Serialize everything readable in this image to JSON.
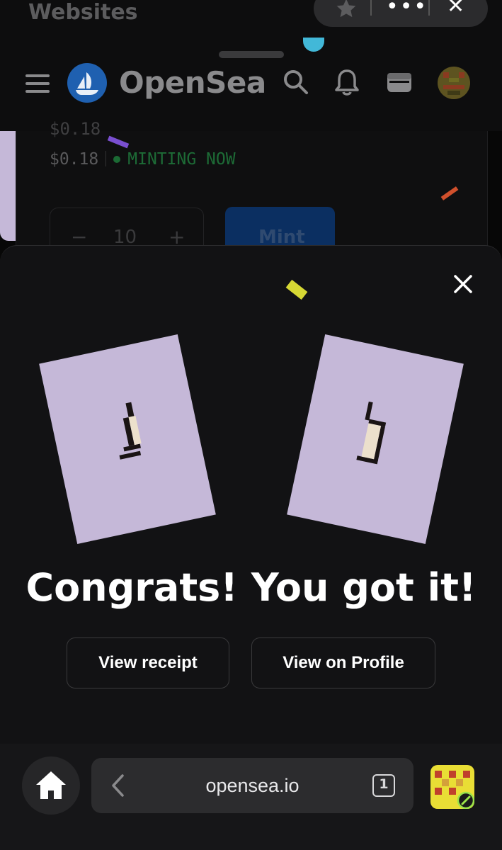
{
  "status_bar": {
    "partial_title": "Websites"
  },
  "browser_pill": {
    "star_icon": "star-icon",
    "menu_icon": "more-dots-icon",
    "close_icon": "close-icon",
    "dots_text": "•••",
    "close_text": "✕"
  },
  "nav": {
    "brand": "OpenSea",
    "menu_icon": "hamburger-icon",
    "logo_icon": "opensea-logo-icon",
    "search_icon": "search-icon",
    "notifications_icon": "bell-icon",
    "wallet_icon": "wallet-icon",
    "avatar_icon": "profile-avatar"
  },
  "page": {
    "price_partial": "$0.18",
    "price": "$0.18",
    "status": "MINTING NOW",
    "quantity": {
      "minus": "−",
      "value": "10",
      "plus": "+"
    },
    "mint_label": "Mint"
  },
  "modal": {
    "title": "Congrats! You got it!",
    "buttons": {
      "view_receipt": "View receipt",
      "view_profile": "View on Profile"
    },
    "close_icon": "close-icon",
    "nft_art": "pixel-cat-nft",
    "card_color": "#c5b8d8"
  },
  "bottom_bar": {
    "home_icon": "home-icon",
    "back_icon": "chevron-left-icon",
    "url": "opensea.io",
    "tab_count": "1",
    "extension_icon": "extension-icon"
  },
  "colors": {
    "background": "#070707",
    "modal": "#121214",
    "accent_blue": "#1f60b0",
    "minting_green": "#1d6b36"
  }
}
